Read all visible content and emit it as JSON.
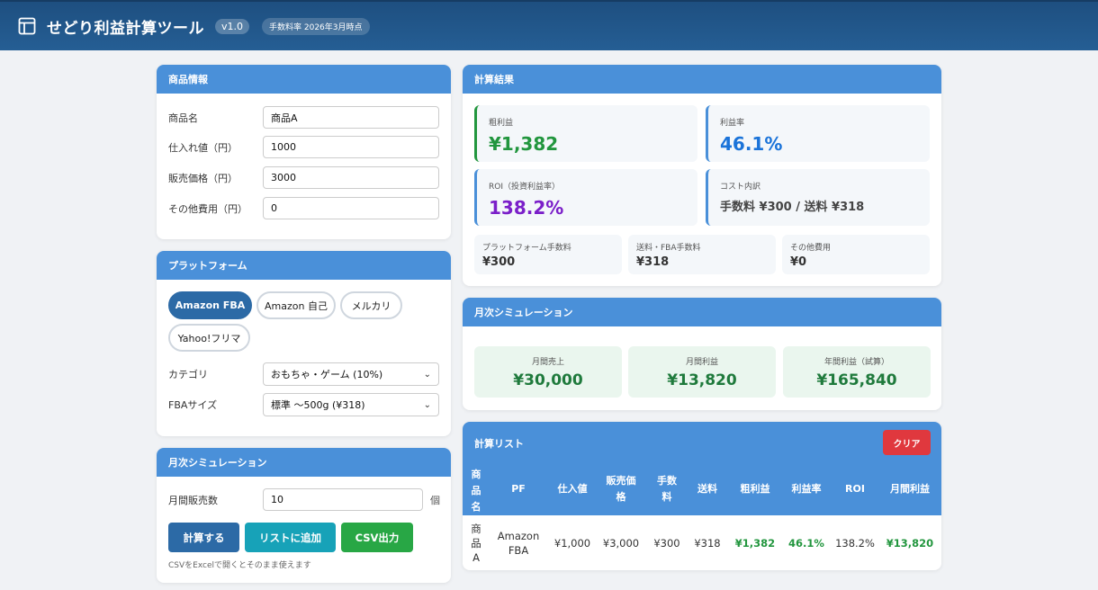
{
  "header": {
    "title": "せどり利益計算ツール",
    "version": "v1.0",
    "fee_note": "手数料率 2026年3月時点"
  },
  "product": {
    "title": "商品情報",
    "fields": [
      {
        "label": "商品名",
        "value": "商品A"
      },
      {
        "label": "仕入れ値（円）",
        "value": "1000"
      },
      {
        "label": "販売価格（円）",
        "value": "3000"
      },
      {
        "label": "その他費用（円）",
        "value": "0"
      }
    ]
  },
  "platform": {
    "title": "プラットフォーム",
    "options": [
      "Amazon FBA",
      "Amazon 自己",
      "メルカリ",
      "Yahoo!フリマ"
    ],
    "selected": "Amazon FBA",
    "category_label": "カテゴリ",
    "category_value": "おもちゃ・ゲーム (10%)",
    "fba_label": "FBAサイズ",
    "fba_value": "標準 〜500g (¥318)"
  },
  "monthly_input": {
    "title": "月次シミュレーション",
    "label": "月間販売数",
    "value": "10",
    "unit": "個",
    "calc_button": "計算する",
    "add_button": "リストに追加",
    "csv_button": "CSV出力",
    "csv_note": "CSVをExcelで開くとそのまま使えます"
  },
  "result": {
    "title": "計算結果",
    "gross_label": "粗利益",
    "gross_value": "¥1,382",
    "margin_label": "利益率",
    "margin_value": "46.1%",
    "roi_label": "ROI（投資利益率）",
    "roi_value": "138.2%",
    "cost_label": "コスト内訳",
    "cost_value": "手数料 ¥300 / 送料 ¥318",
    "platform_fee_label": "プラットフォーム手数料",
    "platform_fee_value": "¥300",
    "shipping_label": "送料・FBA手数料",
    "shipping_value": "¥318",
    "other_label": "その他費用",
    "other_value": "¥0"
  },
  "monthly_result": {
    "title": "月次シミュレーション",
    "sales_label": "月間売上",
    "sales_value": "¥30,000",
    "profit_label": "月間利益",
    "profit_value": "¥13,820",
    "annual_label": "年間利益（試算）",
    "annual_value": "¥165,840"
  },
  "list": {
    "title": "計算リスト",
    "clear_button": "クリア",
    "columns": [
      "商品名",
      "PF",
      "仕入値",
      "販売価格",
      "手数料",
      "送料",
      "粗利益",
      "利益率",
      "ROI",
      "月間利益"
    ],
    "rows": [
      {
        "name": "商品A",
        "pf": "Amazon FBA",
        "cost": "¥1,000",
        "price": "¥3,000",
        "fee": "¥300",
        "ship": "¥318",
        "gross": "¥1,382",
        "margin": "46.1%",
        "roi": "138.2%",
        "monthly": "¥13,820"
      }
    ]
  },
  "colors": {
    "header_bg": "#255e94",
    "card_header": "#4a90d9",
    "active_pill": "#2c6aa6",
    "profit_green": "#22963e",
    "margin_blue": "#1a73d9",
    "roi_purple": "#7b1fc9",
    "clear_red": "#e0383e",
    "add_teal": "#17a2b8",
    "csv_green": "#28a745"
  }
}
